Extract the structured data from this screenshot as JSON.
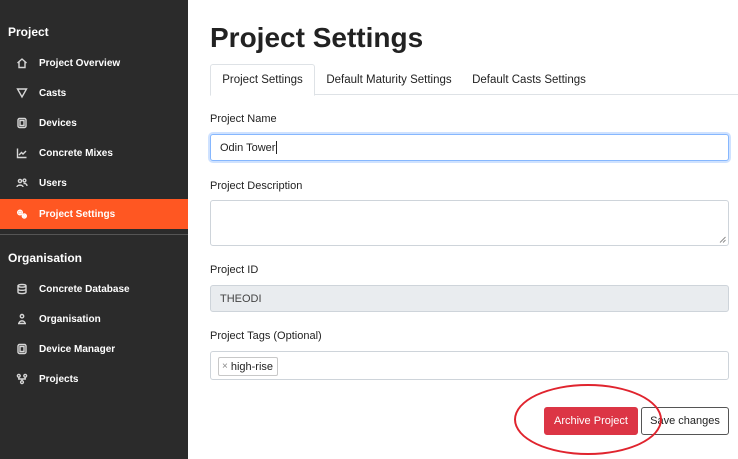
{
  "sidebar": {
    "project_section": "Project",
    "project_items": [
      {
        "label": "Project Overview",
        "icon": "home-icon"
      },
      {
        "label": "Casts",
        "icon": "funnel-icon"
      },
      {
        "label": "Devices",
        "icon": "device-icon"
      },
      {
        "label": "Concrete Mixes",
        "icon": "chart-line-icon"
      },
      {
        "label": "Users",
        "icon": "users-icon"
      },
      {
        "label": "Project Settings",
        "icon": "settings-icon",
        "active": true
      }
    ],
    "organisation_section": "Organisation",
    "organisation_items": [
      {
        "label": "Concrete Database",
        "icon": "database-icon"
      },
      {
        "label": "Organisation",
        "icon": "organisation-icon"
      },
      {
        "label": "Device Manager",
        "icon": "device-icon"
      },
      {
        "label": "Projects",
        "icon": "projects-icon"
      }
    ],
    "active_color": "#ff5722"
  },
  "page": {
    "title": "Project Settings",
    "tabs": [
      {
        "label": "Project Settings",
        "active": true
      },
      {
        "label": "Default Maturity Settings",
        "active": false
      },
      {
        "label": "Default Casts Settings",
        "active": false
      }
    ]
  },
  "form": {
    "project_name_label": "Project Name",
    "project_name_value": "Odin Tower",
    "project_description_label": "Project Description",
    "project_description_value": "",
    "project_id_label": "Project ID",
    "project_id_value": "THEODI",
    "project_tags_label": "Project Tags (Optional)",
    "tags": [
      {
        "remove": "×",
        "label": "high-rise"
      }
    ]
  },
  "actions": {
    "archive_label": "Archive Project",
    "save_label": "Save changes",
    "archive_color": "#dc3545"
  }
}
